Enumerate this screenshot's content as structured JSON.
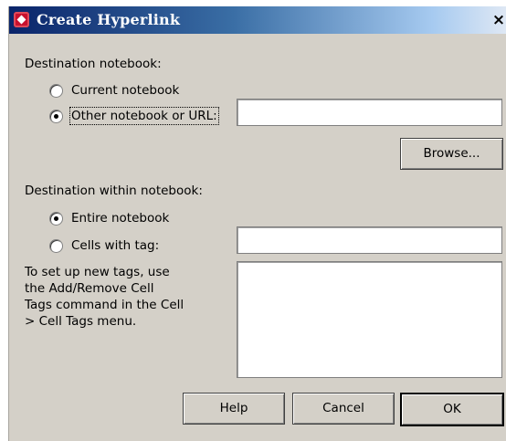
{
  "window": {
    "title": "Create Hyperlink",
    "close_label": "×"
  },
  "destination_notebook": {
    "heading": "Destination notebook:",
    "options": [
      {
        "label": "Current notebook",
        "selected": false
      },
      {
        "label": "Other notebook or URL:",
        "selected": true
      }
    ],
    "url_value": ""
  },
  "browse_label": "Browse...",
  "destination_within": {
    "heading": "Destination within notebook:",
    "options": [
      {
        "label": "Entire notebook",
        "selected": true
      },
      {
        "label": "Cells with tag:",
        "selected": false
      }
    ],
    "tag_value": ""
  },
  "help_text": "To set up new tags, use\nthe Add/Remove Cell\nTags command in the Cell\n> Cell Tags menu.",
  "buttons": {
    "help": "Help",
    "cancel": "Cancel",
    "ok": "OK"
  }
}
